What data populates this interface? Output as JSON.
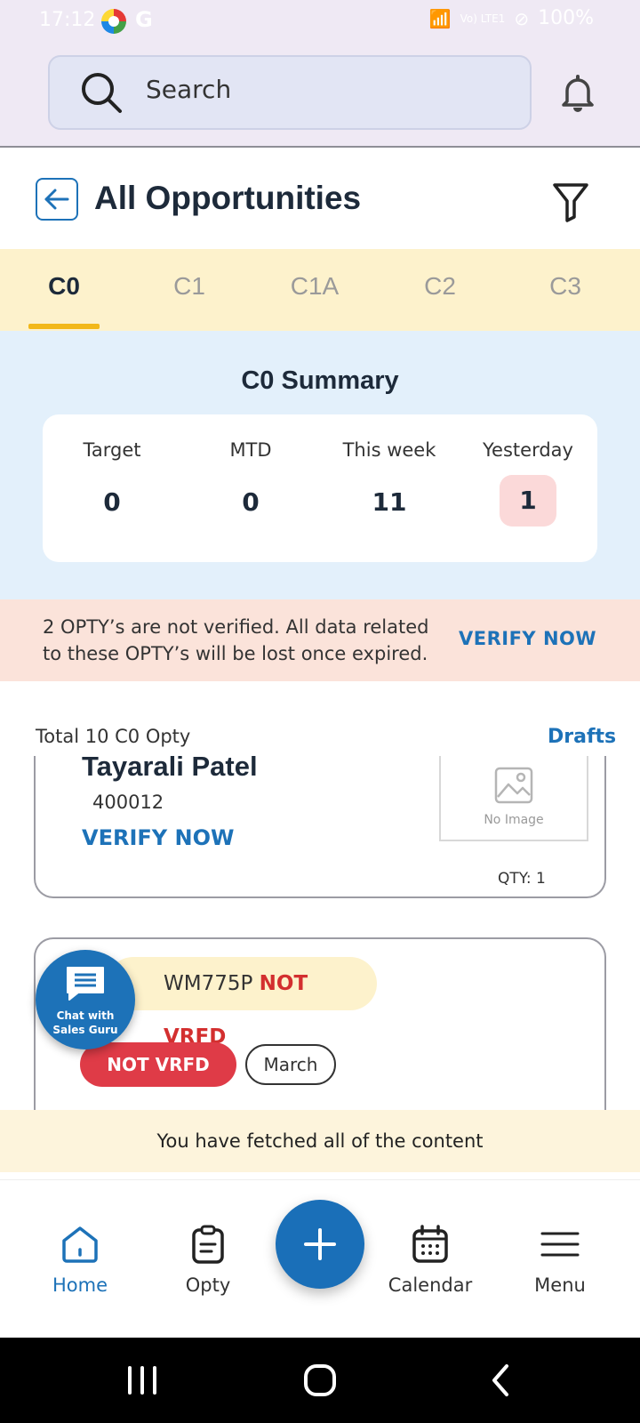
{
  "status_bar": {
    "time": "17:12",
    "app_g": "G",
    "network": "Vo) LTE1",
    "battery": "100%"
  },
  "search": {
    "placeholder": "Search"
  },
  "header": {
    "title": "All Opportunities"
  },
  "tabs": [
    {
      "label": "C0",
      "active": true
    },
    {
      "label": "C1",
      "active": false
    },
    {
      "label": "C1A",
      "active": false
    },
    {
      "label": "C2",
      "active": false
    },
    {
      "label": "C3",
      "active": false
    }
  ],
  "summary": {
    "title": "C0 Summary",
    "stats": [
      {
        "label": "Target",
        "value": "0"
      },
      {
        "label": "MTD",
        "value": "0"
      },
      {
        "label": "This week",
        "value": "11"
      },
      {
        "label": "Yesterday",
        "value": "1"
      }
    ]
  },
  "verify_banner": {
    "message": "2 OPTY’s are not verified. All data related to these OPTY’s will be lost once expired.",
    "action": "VERIFY NOW"
  },
  "list": {
    "total": "Total 10 C0 Opty",
    "drafts": "Drafts",
    "cards": [
      {
        "name": "Tayarali Patel",
        "pincode": "400012",
        "action": "VERIFY NOW",
        "image_text": "No Image",
        "qty": "QTY: 1"
      },
      {
        "vehicle": "WM775P",
        "vehicle_status": "NOT VRFD",
        "badge": "NOT VRFD",
        "month": "March"
      }
    ]
  },
  "chat_fab": {
    "line1": "Chat with",
    "line2": "Sales Guru"
  },
  "fetched_message": "You have fetched all of the content",
  "bottom_nav": {
    "home": "Home",
    "opty": "Opty",
    "calendar": "Calendar",
    "menu": "Menu"
  },
  "colors": {
    "accent": "#1d72b8",
    "tab_bar": "#fdf2cc",
    "summary_bg": "#e3f0fb",
    "banner_bg": "#fbe3da",
    "danger": "#df3b47"
  }
}
